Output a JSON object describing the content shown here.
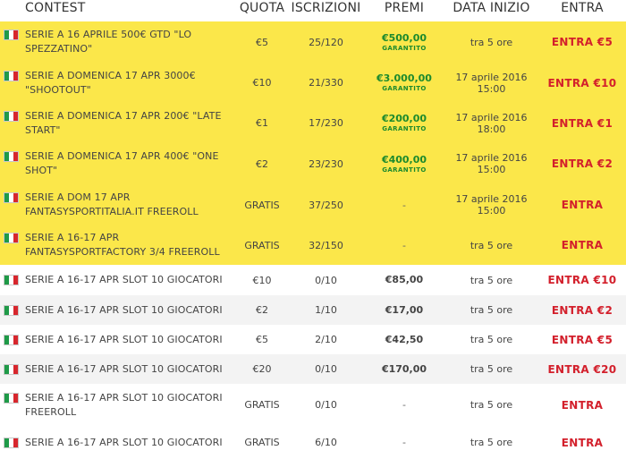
{
  "headers": {
    "contest": "CONTEST",
    "quota": "QUOTA",
    "iscrizioni": "ISCRIZIONI",
    "premi": "PREMI",
    "data_inizio": "DATA INIZIO",
    "entra": "ENTRA"
  },
  "colors": {
    "featured_bg": "#fbe74a",
    "entra_red": "#d3202c",
    "garantito_green": "#1c8a2d"
  },
  "flag_icon": "italy-flag-icon",
  "rows": [
    {
      "name": "SERIE A 16 APRILE 500€ GTD \"LO SPEZZATINO\"",
      "quota": "€5",
      "iscrizioni": "25/120",
      "premi": "€500,00",
      "garantito": "GARANTITO",
      "data": "tra 5 ore",
      "entra": "ENTRA €5"
    },
    {
      "name": "SERIE A DOMENICA 17 APR 3000€ \"SHOOTOUT\"",
      "quota": "€10",
      "iscrizioni": "21/330",
      "premi": "€3.000,00",
      "garantito": "GARANTITO",
      "data": "17 aprile 2016 15:00",
      "entra": "ENTRA €10"
    },
    {
      "name": "SERIE A DOMENICA 17 APR 200€ \"LATE START\"",
      "quota": "€1",
      "iscrizioni": "17/230",
      "premi": "€200,00",
      "garantito": "GARANTITO",
      "data": "17 aprile 2016 18:00",
      "entra": "ENTRA €1"
    },
    {
      "name": "SERIE A DOMENICA 17 APR 400€ \"ONE SHOT\"",
      "quota": "€2",
      "iscrizioni": "23/230",
      "premi": "€400,00",
      "garantito": "GARANTITO",
      "data": "17 aprile 2016 15:00",
      "entra": "ENTRA €2"
    },
    {
      "name": "SERIE A DOM 17 APR FANTASYSPORTITALIA.IT FREEROLL",
      "quota": "GRATIS",
      "iscrizioni": "37/250",
      "premi": "-",
      "data": "17 aprile 2016 15:00",
      "entra": "ENTRA"
    },
    {
      "name": "SERIE A 16-17 APR FANTASYSPORTFACTORY 3/4 FREEROLL",
      "quota": "GRATIS",
      "iscrizioni": "32/150",
      "premi": "-",
      "data": "tra 5 ore",
      "entra": "ENTRA"
    },
    {
      "name": "SERIE A 16-17 APR SLOT 10 GIOCATORI",
      "quota": "€10",
      "iscrizioni": "0/10",
      "premi": "€85,00",
      "data": "tra 5 ore",
      "entra": "ENTRA €10"
    },
    {
      "name": "SERIE A 16-17 APR SLOT 10 GIOCATORI",
      "quota": "€2",
      "iscrizioni": "1/10",
      "premi": "€17,00",
      "data": "tra 5 ore",
      "entra": "ENTRA €2"
    },
    {
      "name": "SERIE A 16-17 APR SLOT 10 GIOCATORI",
      "quota": "€5",
      "iscrizioni": "2/10",
      "premi": "€42,50",
      "data": "tra 5 ore",
      "entra": "ENTRA €5"
    },
    {
      "name": "SERIE A 16-17 APR SLOT 10 GIOCATORI",
      "quota": "€20",
      "iscrizioni": "0/10",
      "premi": "€170,00",
      "data": "tra 5 ore",
      "entra": "ENTRA €20"
    },
    {
      "name": "SERIE A 16-17 APR SLOT 10 GIOCATORI FREEROLL",
      "quota": "GRATIS",
      "iscrizioni": "0/10",
      "premi": "-",
      "data": "tra 5 ore",
      "entra": "ENTRA"
    },
    {
      "name": "SERIE A 16-17 APR SLOT 10 GIOCATORI",
      "quota": "GRATIS",
      "iscrizioni": "6/10",
      "premi": "-",
      "data": "tra 5 ore",
      "entra": "ENTRA"
    }
  ]
}
